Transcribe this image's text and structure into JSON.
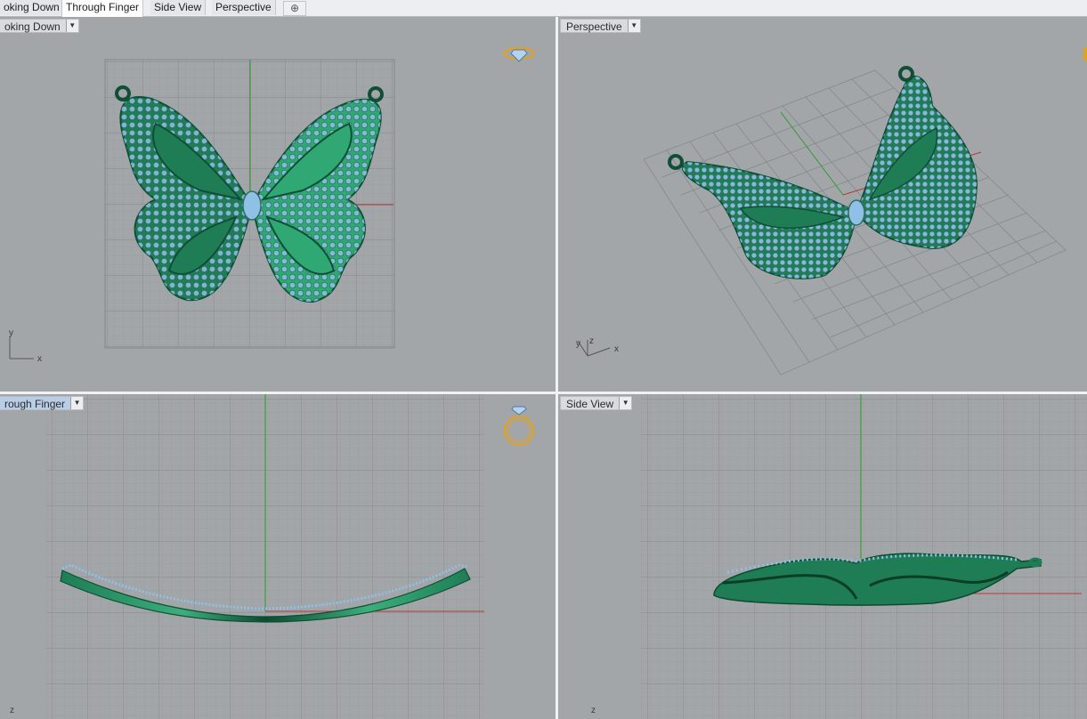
{
  "tabs": [
    {
      "label": "oking Down",
      "active": false
    },
    {
      "label": "Through Finger",
      "active": true
    },
    {
      "label": "Side View",
      "active": false
    },
    {
      "label": "Perspective",
      "active": false
    }
  ],
  "viewports": {
    "top": {
      "label": "oking Down",
      "axis_x": "x",
      "axis_y": "y"
    },
    "perspective": {
      "label": "Perspective",
      "axis_x": "x",
      "axis_y": "y",
      "axis_z": "z"
    },
    "front": {
      "label": "rough Finger",
      "axis_z": "z"
    },
    "side": {
      "label": "Side View",
      "axis_z": "z"
    }
  },
  "colors": {
    "background": "#a3a6a9",
    "grid_minor": "#979a9e",
    "grid_major": "#85888c",
    "axis_x": "#b23a3a",
    "axis_y": "#2e9a2e",
    "metal": "#1e7d55",
    "metal_light": "#3cae7c",
    "stone": "#8fc0e6",
    "gumball": "#e3a21a"
  },
  "icons": {
    "view_top": "ring-gem-top-icon",
    "view_front": "ring-front-icon",
    "dropdown": "chevron-down-icon",
    "add_tab": "plus-icon"
  }
}
